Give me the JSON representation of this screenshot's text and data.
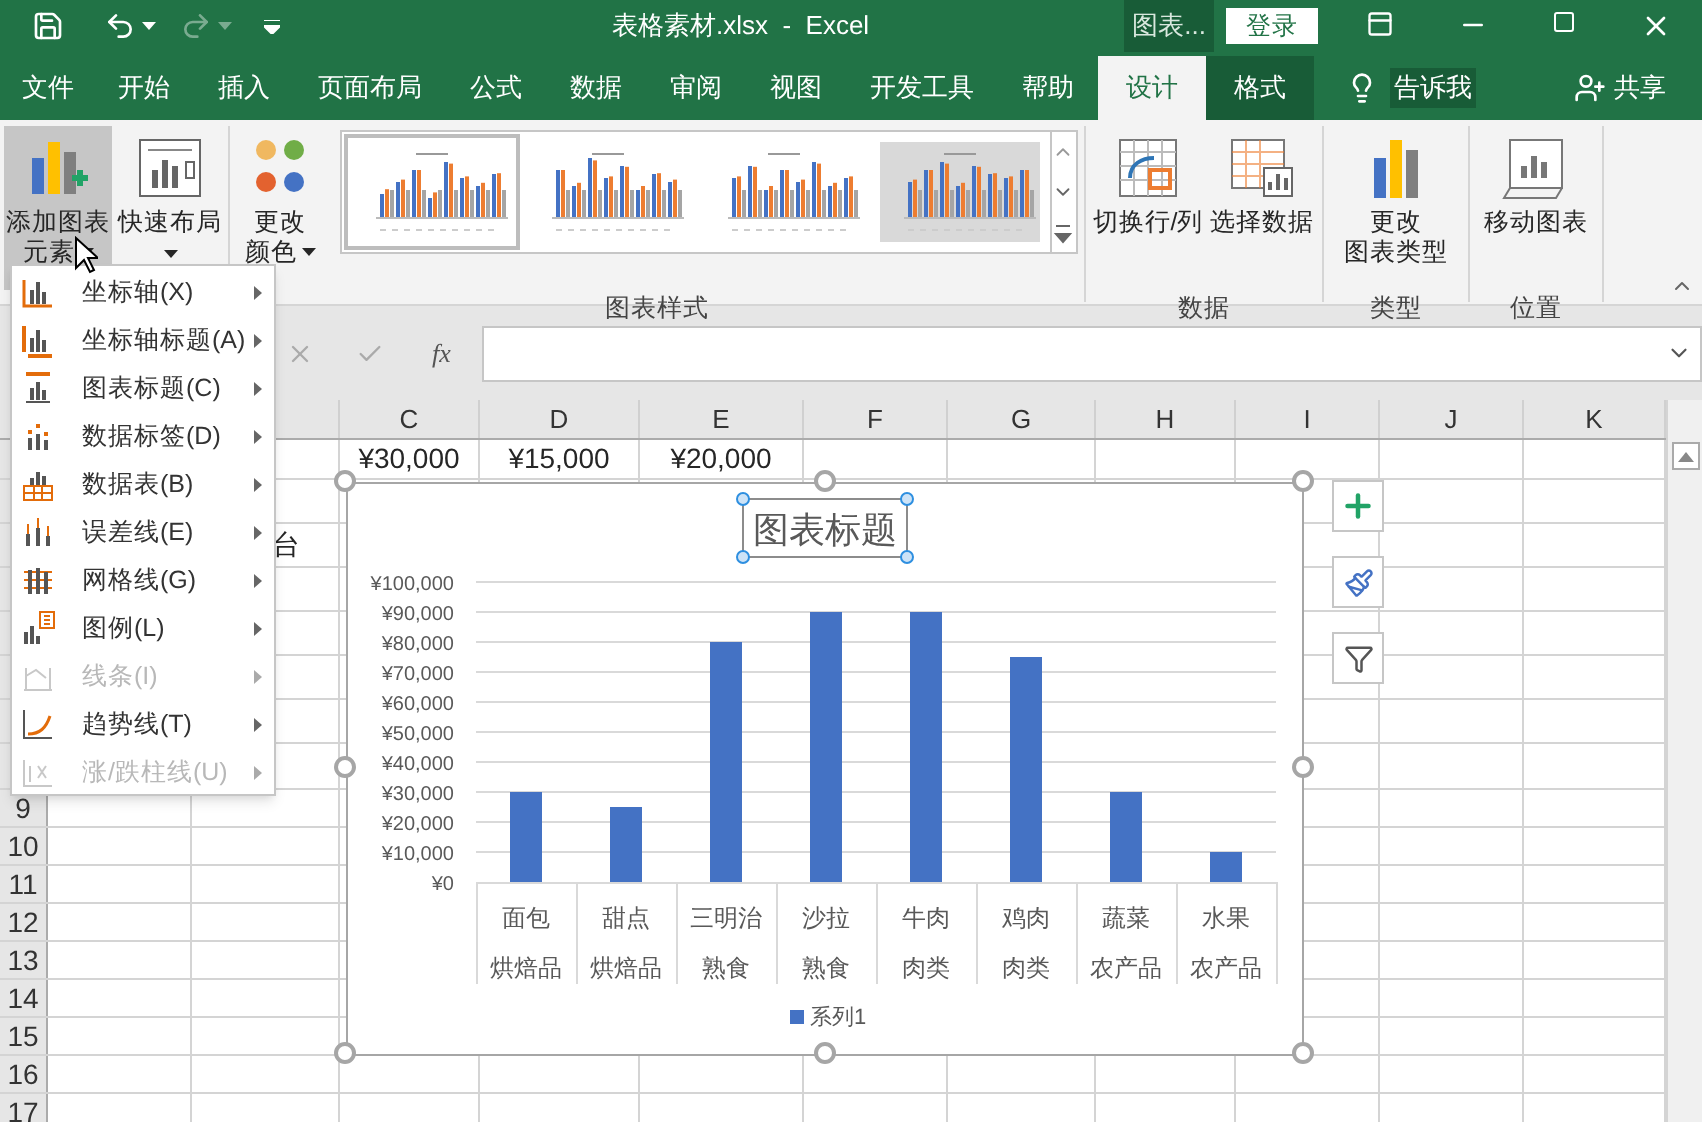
{
  "title_bar": {
    "title": "表格素材.xlsx  -  Excel",
    "context_label": "图表...",
    "sign_in": "登录"
  },
  "tabs": [
    {
      "label": "文件",
      "selected": false,
      "kind": "normal"
    },
    {
      "label": "开始",
      "selected": false,
      "kind": "normal"
    },
    {
      "label": "插入",
      "selected": false,
      "kind": "normal"
    },
    {
      "label": "页面布局",
      "selected": false,
      "kind": "normal"
    },
    {
      "label": "公式",
      "selected": false,
      "kind": "normal"
    },
    {
      "label": "数据",
      "selected": false,
      "kind": "normal"
    },
    {
      "label": "审阅",
      "selected": false,
      "kind": "normal"
    },
    {
      "label": "视图",
      "selected": false,
      "kind": "normal"
    },
    {
      "label": "开发工具",
      "selected": false,
      "kind": "normal"
    },
    {
      "label": "帮助",
      "selected": false,
      "kind": "normal"
    },
    {
      "label": "设计",
      "selected": true,
      "kind": "context"
    },
    {
      "label": "格式",
      "selected": false,
      "kind": "context"
    }
  ],
  "tell_me": "告诉我",
  "share": "共享",
  "ribbon": {
    "groups": [
      {
        "buttons": [
          {
            "kind": "add-element",
            "lines": [
              "添加图表",
              "元素"
            ],
            "pressed": true,
            "dropdown": true
          },
          {
            "kind": "quick-layout",
            "lines": [
              "快速布局"
            ],
            "pressed": false,
            "dropdown": true
          }
        ]
      },
      {
        "label": "图表样式",
        "buttons": [
          {
            "kind": "colors",
            "lines": [
              "更改",
              "颜色"
            ],
            "pressed": false,
            "dropdown": true
          }
        ],
        "gallery": [
          {
            "selected": true
          },
          {
            "selected": false
          },
          {
            "selected": false
          },
          {
            "selected": false
          }
        ]
      },
      {
        "label": "数据",
        "buttons": [
          {
            "kind": "switch",
            "lines": [
              "切换行/列"
            ],
            "pressed": false,
            "dropdown": false
          },
          {
            "kind": "select-data",
            "lines": [
              "选择数据"
            ],
            "pressed": false,
            "dropdown": false
          }
        ]
      },
      {
        "label": "类型",
        "buttons": [
          {
            "kind": "change-type",
            "lines": [
              "更改",
              "图表类型"
            ],
            "pressed": false,
            "dropdown": false
          }
        ]
      },
      {
        "label": "位置",
        "buttons": [
          {
            "kind": "move",
            "lines": [
              "移动图表"
            ],
            "pressed": false,
            "dropdown": false
          }
        ]
      }
    ]
  },
  "formula_bar": {
    "function_label": "fx"
  },
  "sheet": {
    "columns": [
      "C",
      "D",
      "E",
      "F",
      "G",
      "H",
      "I",
      "J",
      "K"
    ],
    "row_labels": [
      "9",
      "10",
      "11",
      "12",
      "13",
      "14",
      "15",
      "16",
      "17"
    ],
    "first_row_values": [
      "¥30,000",
      "¥15,000",
      "¥20,000"
    ],
    "third_row_text": "台"
  },
  "chart": {
    "category_groups": [
      "烘焙品",
      "烘焙品",
      "熟食",
      "熟食",
      "肉类",
      "肉类",
      "农产品",
      "农产品"
    ],
    "chart_data": {
      "type": "bar",
      "title": "图表标题",
      "grid": true,
      "categories": [
        "面包",
        "甜点",
        "三明治",
        "沙拉",
        "牛肉",
        "鸡肉",
        "蔬菜",
        "水果"
      ],
      "series": [
        {
          "name": "系列1",
          "color": "#4472c4",
          "values": [
            30000,
            25000,
            80000,
            90000,
            90000,
            75000,
            30000,
            10000
          ]
        }
      ],
      "ylim": [
        0,
        100000
      ],
      "yticks": [
        {
          "value": 0,
          "label": "¥0"
        },
        {
          "value": 10000,
          "label": "¥10,000"
        },
        {
          "value": 20000,
          "label": "¥20,000"
        },
        {
          "value": 30000,
          "label": "¥30,000"
        },
        {
          "value": 40000,
          "label": "¥40,000"
        },
        {
          "value": 50000,
          "label": "¥50,000"
        },
        {
          "value": 60000,
          "label": "¥60,000"
        },
        {
          "value": 70000,
          "label": "¥70,000"
        },
        {
          "value": 80000,
          "label": "¥80,000"
        },
        {
          "value": 90000,
          "label": "¥90,000"
        },
        {
          "value": 100000,
          "label": "¥100,000"
        }
      ]
    }
  },
  "menu": {
    "items": [
      {
        "label": "坐标轴(X)",
        "disabled": false,
        "kind": "axes"
      },
      {
        "label": "坐标轴标题(A)",
        "disabled": false,
        "kind": "axis-title"
      },
      {
        "label": "图表标题(C)",
        "disabled": false,
        "kind": "chart-title"
      },
      {
        "label": "数据标签(D)",
        "disabled": false,
        "kind": "data-labels"
      },
      {
        "label": "数据表(B)",
        "disabled": false,
        "kind": "data-table"
      },
      {
        "label": "误差线(E)",
        "disabled": false,
        "kind": "error-bars"
      },
      {
        "label": "网格线(G)",
        "disabled": false,
        "kind": "gridlines"
      },
      {
        "label": "图例(L)",
        "disabled": false,
        "kind": "legend"
      },
      {
        "label": "线条(I)",
        "disabled": true,
        "kind": "lines"
      },
      {
        "label": "趋势线(T)",
        "disabled": false,
        "kind": "trendline"
      },
      {
        "label": "涨/跌柱线(U)",
        "disabled": true,
        "kind": "updown"
      }
    ]
  }
}
